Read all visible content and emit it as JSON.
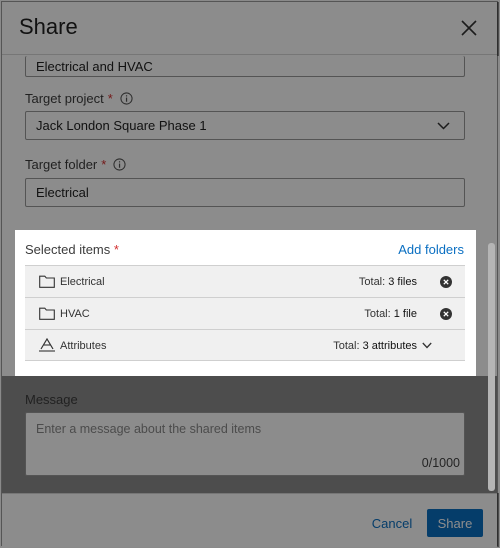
{
  "dialog": {
    "title": "Share",
    "close_icon": "close-icon"
  },
  "form": {
    "project_field_value": "Electrical and HVAC",
    "target_project": {
      "label": "Target project",
      "required_mark": "*",
      "value": "Jack London Square Phase 1"
    },
    "target_folder": {
      "label": "Target folder",
      "required_mark": "*",
      "value": "Electrical"
    }
  },
  "selected_items": {
    "title": "Selected items",
    "required_mark": "*",
    "add_folders_label": "Add folders",
    "rows": [
      {
        "name": "Electrical",
        "total_label": "Total:",
        "total_value": "3 files",
        "icon": "folder-icon"
      },
      {
        "name": "HVAC",
        "total_label": "Total:",
        "total_value": "1 file",
        "icon": "folder-icon"
      },
      {
        "name": "Attributes",
        "total_label": "Total:",
        "total_value": "3 attributes",
        "icon": "attributes-icon"
      }
    ]
  },
  "message": {
    "label": "Message",
    "placeholder": "Enter a message about the shared items",
    "counter": "0/1000"
  },
  "footer": {
    "cancel_label": "Cancel",
    "share_label": "Share"
  },
  "colors": {
    "accent": "#0a6fc2",
    "required": "#d32f2f",
    "overlay": "#000000"
  }
}
